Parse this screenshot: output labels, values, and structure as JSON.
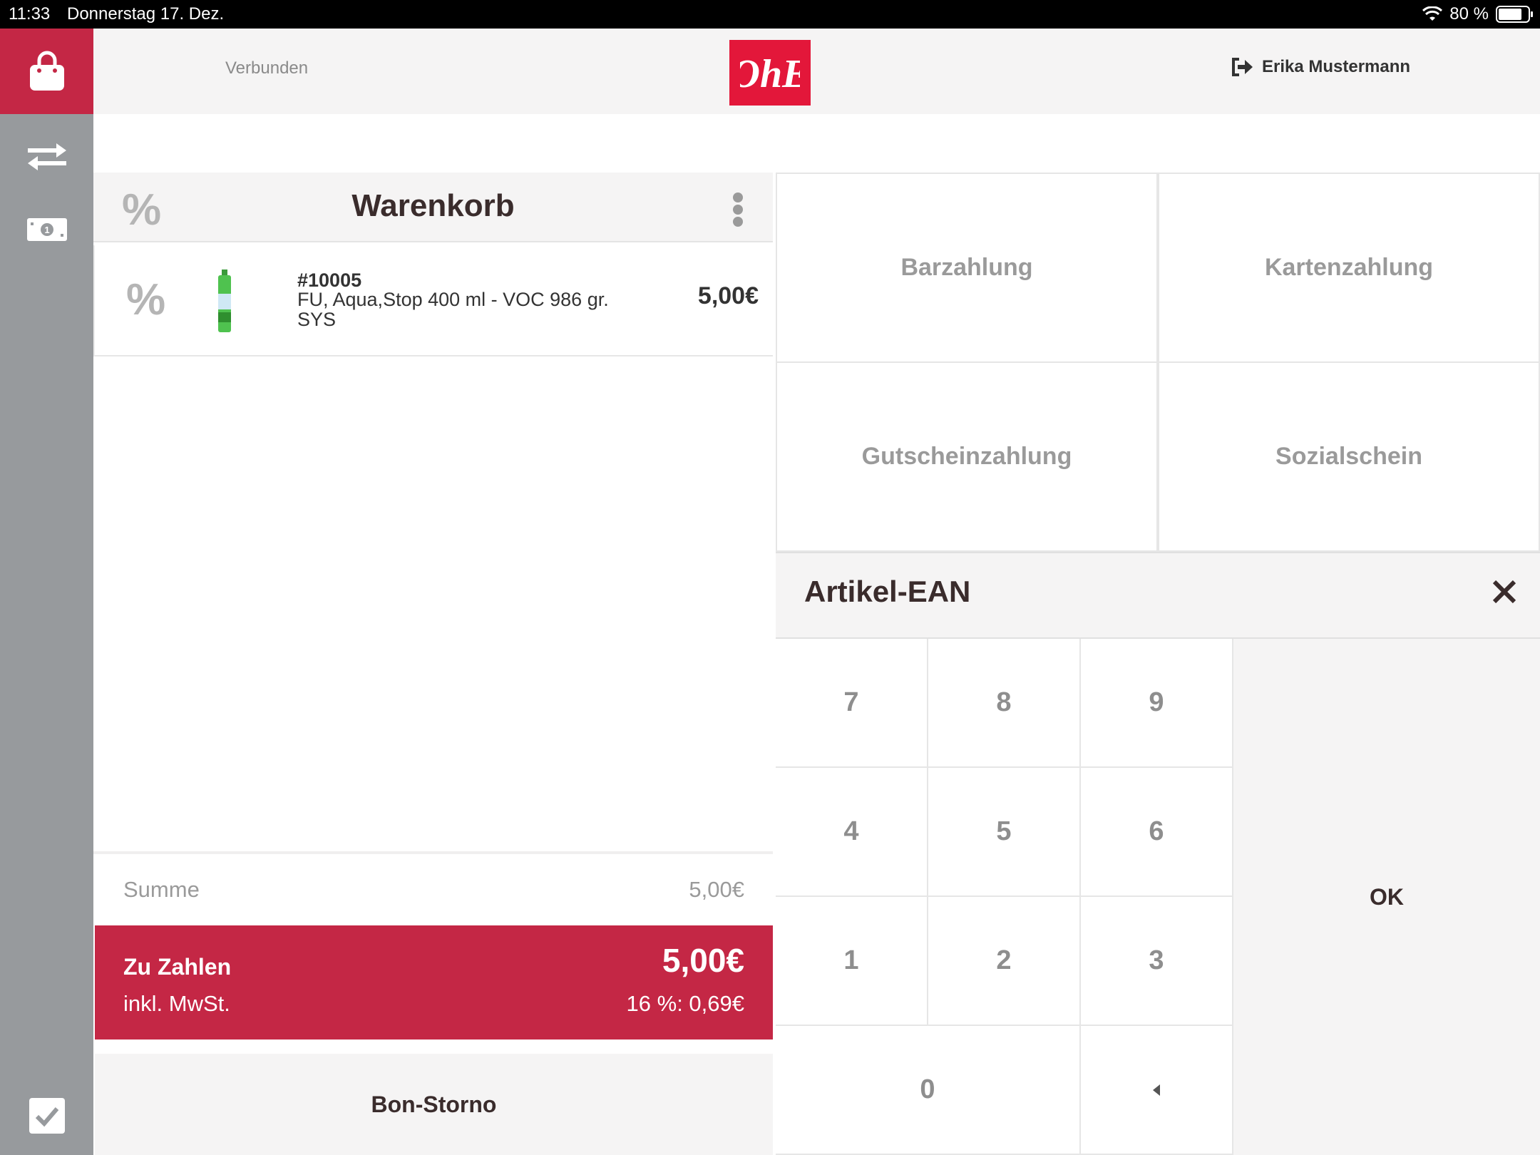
{
  "status_bar": {
    "time": "11:33",
    "date": "Donnerstag 17. Dez.",
    "battery": "80 %",
    "battery_level": 0.8
  },
  "sidebar": {
    "items": [
      {
        "icon": "shopping-bag-icon",
        "active": true
      },
      {
        "icon": "transfer-arrows-icon",
        "active": false
      },
      {
        "icon": "cash-icon",
        "active": false
      },
      {
        "icon": "checkmark-icon",
        "active": false
      }
    ]
  },
  "header": {
    "connection_status": "Verbunden",
    "logo_text": "OhE",
    "user_name": "Erika Mustermann"
  },
  "cart": {
    "title": "Warenkorb",
    "discount_symbol": "%",
    "items": [
      {
        "sku": "#10005",
        "name": "FU, Aqua,Stop 400 ml - VOC 986 gr. SYS",
        "price": "5,00€"
      }
    ],
    "sum_label": "Summe",
    "sum_value": "5,00€",
    "to_pay_label": "Zu Zahlen",
    "to_pay_amount": "5,00€",
    "vat_label": "inkl. MwSt.",
    "vat_value": "16 %: 0,69€",
    "storno_label": "Bon-Storno"
  },
  "payments": [
    "Barzahlung",
    "Kartenzahlung",
    "Gutscheinzahlung",
    "Sozialschein"
  ],
  "ean": {
    "title": "Artikel-EAN",
    "keys": [
      "7",
      "8",
      "9",
      "4",
      "5",
      "6",
      "1",
      "2",
      "3",
      "0"
    ],
    "ok_label": "OK"
  },
  "colors": {
    "accent": "#c42745",
    "logo": "#e3173a",
    "sidebar": "#979a9d",
    "panel": "#f5f4f4"
  }
}
